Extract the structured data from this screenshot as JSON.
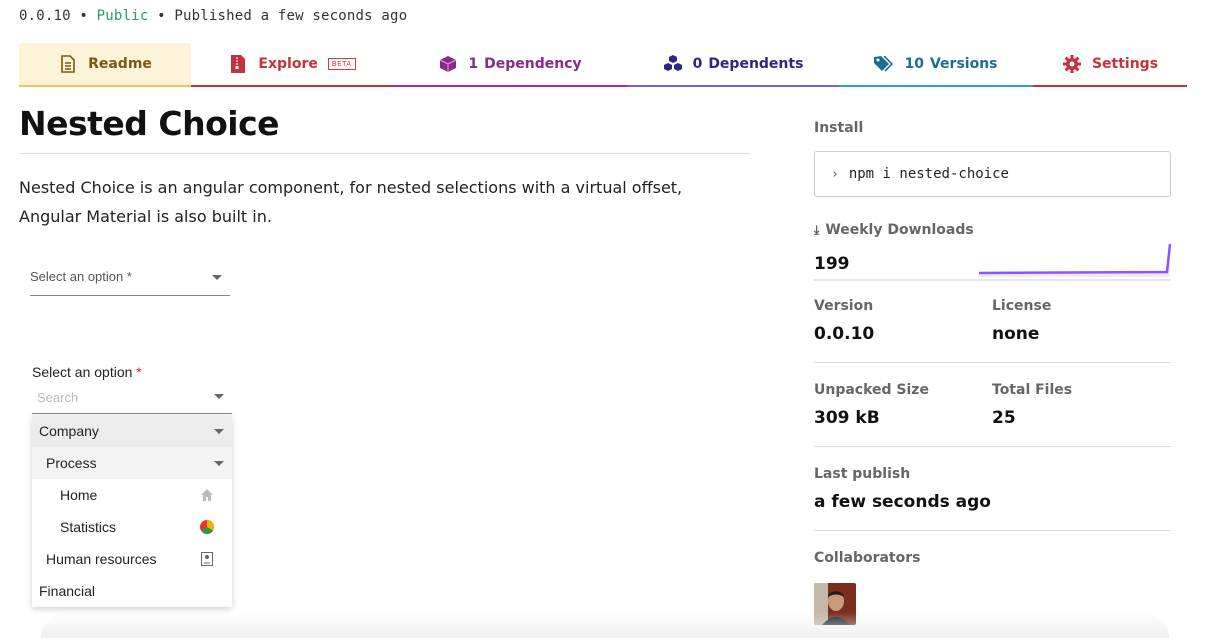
{
  "meta": {
    "version": "0.0.10",
    "sep1": " • ",
    "visibility": "Public",
    "sep2": " • ",
    "published": "Published a few seconds ago"
  },
  "tabs": {
    "readme": {
      "label": "Readme",
      "icon": "document-icon"
    },
    "explore": {
      "label": "Explore",
      "badge": "BETA",
      "icon": "file-zip-icon"
    },
    "dependency": {
      "count": "1",
      "label": "Dependency",
      "icon": "cube-icon"
    },
    "dependents": {
      "count": "0",
      "label": "Dependents",
      "icon": "cubes-icon"
    },
    "versions": {
      "count": "10",
      "label": "Versions",
      "icon": "tags-icon"
    },
    "settings": {
      "label": "Settings",
      "icon": "gear-icon"
    }
  },
  "readme": {
    "title": "Nested Choice",
    "description": "Nested Choice is an angular component, for nested selections with a virtual offset, Angular Material is also built in.",
    "select1_placeholder": "Select an option *",
    "select2_label": "Select an option",
    "select2_required": "*",
    "search_placeholder": "Search",
    "options": {
      "company": "Company",
      "process": "Process",
      "home": "Home",
      "statistics": "Statistics",
      "human_resources": "Human resources",
      "financial": "Financial"
    }
  },
  "sidebar": {
    "install_label": "Install",
    "install_command": "npm i nested-choice",
    "weekly_downloads_label": "Weekly Downloads",
    "weekly_downloads": "199",
    "version_label": "Version",
    "version": "0.0.10",
    "license_label": "License",
    "license": "none",
    "unpacked_size_label": "Unpacked Size",
    "unpacked_size": "309 kB",
    "total_files_label": "Total Files",
    "total_files": "25",
    "last_publish_label": "Last publish",
    "last_publish": "a few seconds ago",
    "collaborators_label": "Collaborators"
  },
  "colors": {
    "public": "#2a9d5c",
    "readme_tab_bg": "#fdf3d8",
    "explore": "#c7323a",
    "dependency": "#8a2a8a",
    "dependents": "#2e2588",
    "versions": "#1a6f8e",
    "sparkline": "#8956ff"
  }
}
